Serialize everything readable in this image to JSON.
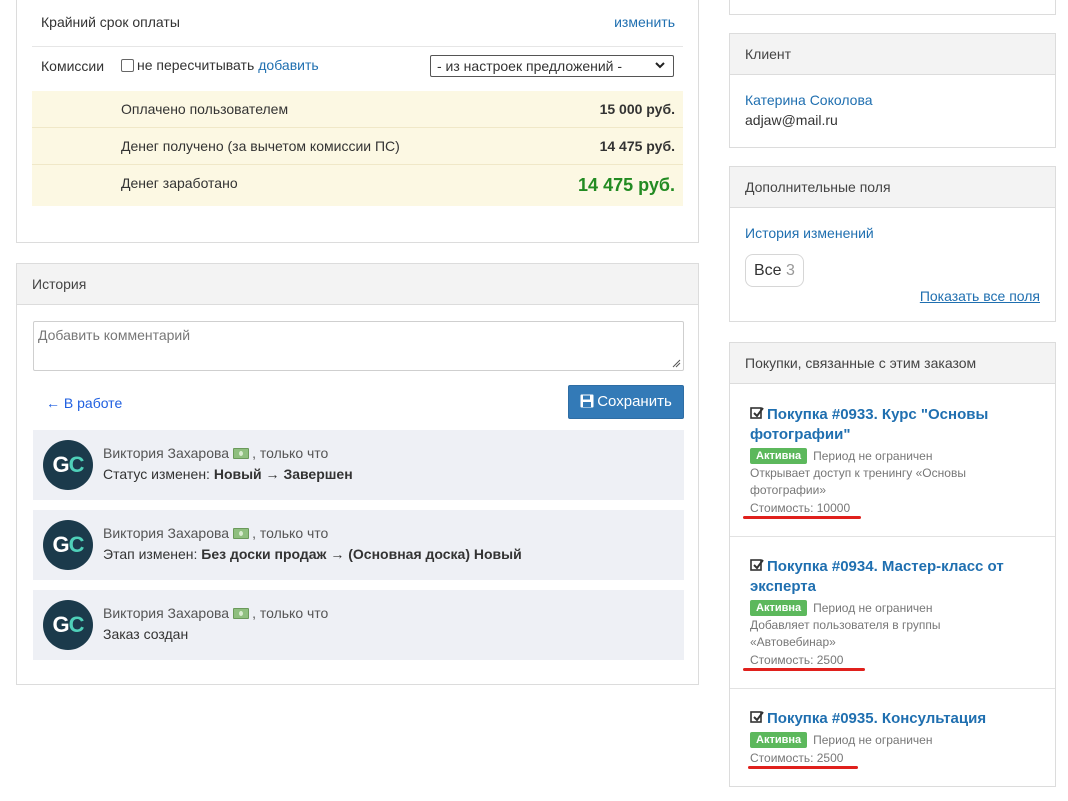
{
  "order": {
    "deadline_label": "Крайний срок оплаты",
    "deadline_action": "изменить",
    "commission_label": "Комиссии",
    "no_recalc_label": "не пересчитывать",
    "add_label": "добавить",
    "settings_select": "- из настроек предложений -",
    "money": [
      {
        "label": "Оплачено пользователем",
        "value": "15 000 руб."
      },
      {
        "label": "Денег получено (за вычетом комиссии ПС)",
        "value": "14 475 руб."
      },
      {
        "label": "Денег заработано",
        "value": "14 475 руб."
      }
    ]
  },
  "history": {
    "title": "История",
    "comment_placeholder": "Добавить комментарий",
    "back_label": "← В работе",
    "save_label": "Сохранить",
    "avatar_text": "GC",
    "entries": [
      {
        "author": "Виктория Захарова",
        "time": ", только что",
        "prefix": "Статус изменен: ",
        "change": "Новый → Завершен"
      },
      {
        "author": "Виктория Захарова",
        "time": ", только что",
        "prefix": "Этап изменен: ",
        "change": "Без доски продаж → (Основная доска) Новый"
      },
      {
        "author": "Виктория Захарова",
        "time": ", только что",
        "prefix": "Заказ создан",
        "change": ""
      }
    ]
  },
  "client": {
    "title": "Клиент",
    "name": "Катерина Соколова",
    "email": "adjaw@mail.ru"
  },
  "extra_fields": {
    "title": "Дополнительные поля",
    "history_link": "История изменений",
    "tag_label": "Все",
    "tag_count": "3",
    "show_all": "Показать все поля"
  },
  "purchases": {
    "title": "Покупки, связанные с этим заказом",
    "items": [
      {
        "title": "Покупка #0933. Курс \"Основы фотографии\"",
        "status": "Активна",
        "period": "Период не ограничен",
        "desc": "Открывает доступ к тренингу «Основы фотографии»",
        "cost": "Стоимость: 10000"
      },
      {
        "title": "Покупка #0934. Мастер-класс от эксперта",
        "status": "Активна",
        "period": "Период не ограничен",
        "desc": "Добавляет пользователя в группы «Автовебинар»",
        "cost": "Стоимость: 2500"
      },
      {
        "title": "Покупка #0935. Консультация",
        "status": "Активна",
        "period": "Период не ограничен",
        "desc": "",
        "cost": "Стоимость: 2500"
      }
    ]
  },
  "colors": {
    "accent_link": "#1f6fb0",
    "save_button": "#337ab7",
    "earned_green": "#228b22",
    "badge_green": "#5cb85c",
    "money_bg": "#fcf8e3",
    "highlight_red": "#e0201c"
  }
}
